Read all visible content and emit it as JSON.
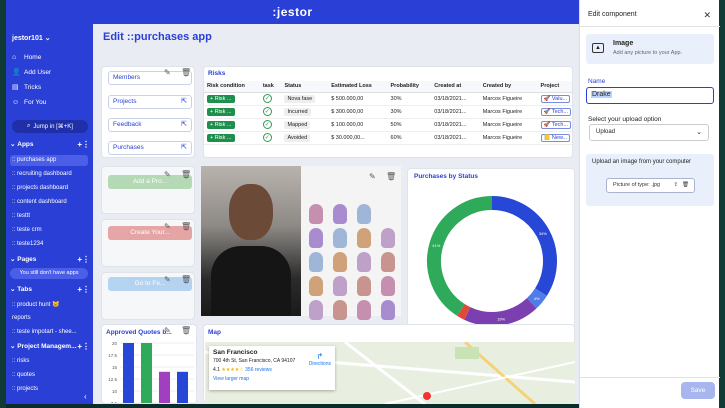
{
  "app": {
    "logo": ":jestor"
  },
  "sidebar": {
    "user": "jestor101",
    "nav": [
      {
        "label": "Home",
        "icon": "home-icon"
      },
      {
        "label": "Add User",
        "icon": "add-user-icon"
      },
      {
        "label": "Tricks",
        "icon": "tricks-icon"
      },
      {
        "label": "For You",
        "icon": "for-you-icon"
      }
    ],
    "jump": "Jump in [⌘+K]",
    "apps_title": "Apps",
    "apps": [
      ":: purchases app",
      ":: recruiting dashboard",
      ":: projects dashboard",
      ":: content dashboard",
      ":: testtt",
      ":: teste crm",
      ":: teste1234"
    ],
    "pages_title": "Pages",
    "pages_empty": "You still don't have apps",
    "tabs_title": "Tabs",
    "tabs": [
      ":: product hunt 😸",
      "reports",
      ":: teste impotart - shee..."
    ],
    "pm_title": "Project Managem...",
    "pm": [
      ":: risks",
      ":: quotes",
      ":: projects"
    ]
  },
  "main": {
    "title": "Edit ::purchases app",
    "links": [
      "Members",
      "Projects",
      "Feedback",
      "Purchases"
    ],
    "risks": {
      "title": "Risks",
      "columns": [
        "Risk condition",
        "task",
        "Status",
        "Estimated Loss",
        "Probability",
        "Created at",
        "Created by",
        "Project"
      ],
      "rows": [
        {
          "btn": "+ Risk ...",
          "status": "Nova fase",
          "loss": "$ 500.000,00",
          "prob": "30%",
          "created": "03/18/2021...",
          "by": "Marcos Figueire",
          "proj": "🚀 Valu..."
        },
        {
          "btn": "+ Risk ...",
          "status": "Incurred",
          "loss": "$ 300.000,00",
          "prob": "30%",
          "created": "03/18/2021...",
          "by": "Marcos Figueire",
          "proj": "🚀 Tech..."
        },
        {
          "btn": "+ Risk ...",
          "status": "Mapped",
          "loss": "$ 100.000,00",
          "prob": "50%",
          "created": "03/18/2021...",
          "by": "Marcos Figueire",
          "proj": "🚀 Tech..."
        },
        {
          "btn": "+ Risk ...",
          "status": "Avoided",
          "loss": "$ 30.000,00...",
          "prob": "60%",
          "created": "03/18/2021...",
          "by": "Marcos Figueire",
          "proj": "📒 New..."
        }
      ]
    },
    "ghost_buttons": [
      "Add a Pro...",
      "Create Your...",
      "Go to Fe..."
    ],
    "purchases_chart_title": "Purchases by Status",
    "quotes_title": "Approved Quotes b...",
    "map": {
      "title": "Map",
      "place": "San Francisco",
      "address": "700 4th St, San Francisco, CA 94107",
      "rating": "4.1",
      "reviews": "356 reviews",
      "larger": "View larger map",
      "directions": "Directions"
    }
  },
  "chart_data": [
    {
      "type": "pie",
      "title": "Purchases by Status",
      "labels": [
        "",
        "",
        "",
        "",
        ""
      ],
      "values": [
        34,
        4,
        19,
        2,
        41
      ],
      "value_labels": [
        "34%",
        "4%",
        "19%",
        "",
        "41%"
      ],
      "colors": [
        "#2747d6",
        "#4f7de8",
        "#7b3fb0",
        "#e04a3a",
        "#2eaa5a"
      ]
    },
    {
      "type": "bar",
      "title": "Approved Quotes b...",
      "y_ticks": [
        "20",
        "17.5",
        "15",
        "12.5",
        "10",
        "7.5"
      ],
      "values": [
        20,
        20,
        14,
        14
      ],
      "colors": [
        "#2747d6",
        "#2eaa5a",
        "#a03fc0",
        "#2747d6"
      ],
      "ylim": [
        7.5,
        20
      ]
    }
  ],
  "panel": {
    "header": "Edit component",
    "image_title": "Image",
    "image_sub": "Add any picture to your App.",
    "name_label": "Name",
    "name_value": "Drake",
    "option_label": "Select your upload option",
    "option_value": "Upload",
    "upload_label": "Upload an image from your computer",
    "file_type": "Picture of type: .jpg",
    "save": "Save"
  }
}
